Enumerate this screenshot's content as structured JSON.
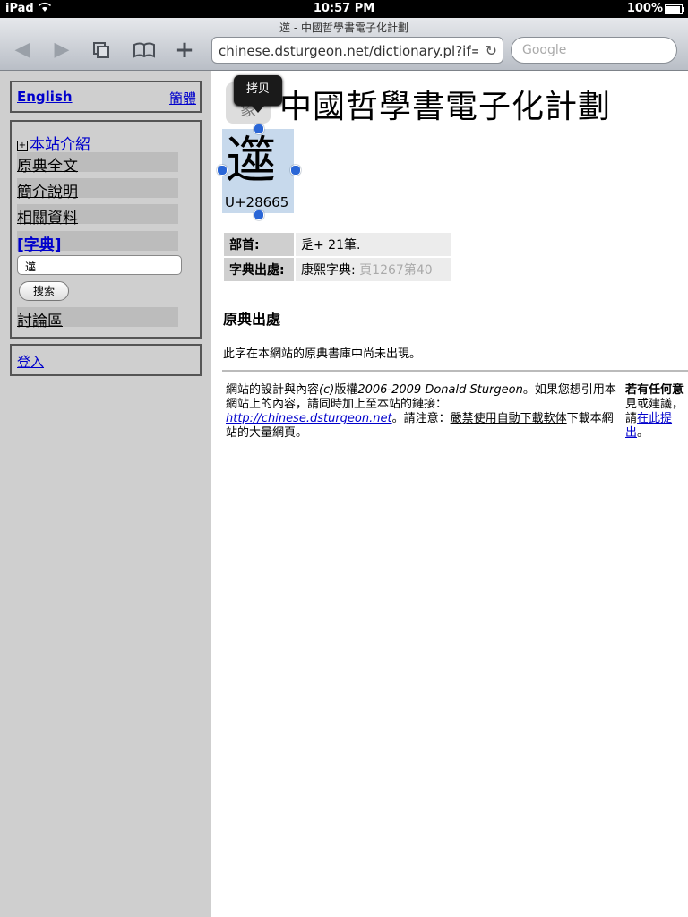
{
  "status_bar": {
    "device": "iPad",
    "time": "10:57 PM",
    "battery": "100%"
  },
  "browser": {
    "page_title": "遾 - 中國哲學書電子化計劃",
    "url": "chinese.dsturgeon.net/dictionary.pl?if=gb...",
    "search_placeholder": "Google",
    "icons": [
      "back-icon",
      "forward-icon",
      "tabs-icon",
      "bookmarks-icon",
      "add-icon",
      "reload-icon"
    ]
  },
  "sidebar": {
    "lang_english": "English",
    "lang_simplified": "簡體",
    "nav_plus": "+",
    "nav": [
      "本站介紹",
      "原典全文",
      "簡介說明",
      "相關資料",
      "[字典]",
      "討論區"
    ],
    "dict_input_value": "遾",
    "search_button": "搜索",
    "login": "登入"
  },
  "header": {
    "title": "中國哲學書電子化計劃",
    "logo_text": "象",
    "copy_popup": "拷贝"
  },
  "character": {
    "glyph": "遾",
    "codepoint": "U+28665"
  },
  "info": {
    "radical_label": "部首:",
    "radical_value": "辵+ 21筆.",
    "source_label": "字典出處:",
    "source_value": "康熙字典:",
    "source_page": "頁1267第40"
  },
  "section": {
    "title": "原典出處",
    "not_found": "此字在本網站的原典書庫中尚未出現。"
  },
  "footer": {
    "l1": "網站的設計與內容",
    "l1_italic": "(c)",
    "l2": "版權",
    "l2_italic": "2006-2009 Donald Sturgeon",
    "l3": "。如果您想引用本網站上的內容，請同時加上至本站的鏈接：",
    "link": "http://chinese.dsturgeon.net",
    "l4": "。請注意：",
    "warning": "嚴禁使用自動下載軟体",
    "l5": "下載本網站的大量網頁。",
    "right_1": "若有任何意",
    "right_2": "見或建議，",
    "right_3": "請",
    "right_link_1": "在此提",
    "right_link_2": "出",
    "right_end": "。"
  }
}
